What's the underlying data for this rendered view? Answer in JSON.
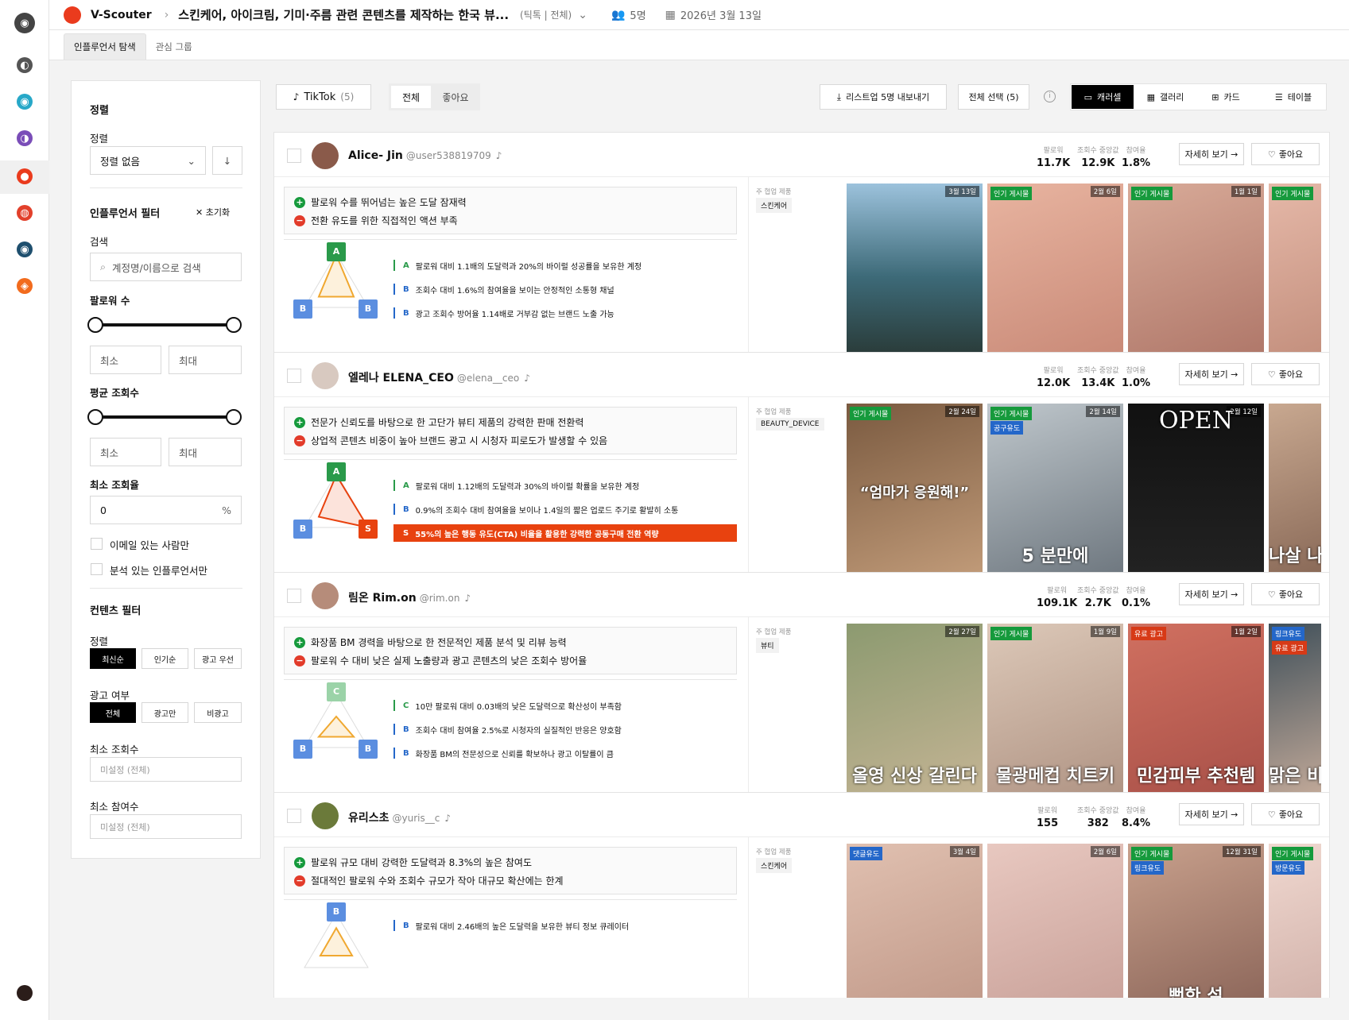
{
  "app": {
    "name": "V-Scouter",
    "project_title": "스킨케어, 아이크림, 기미·주름 관련 콘텐츠를 제작하는 한국 뷰...",
    "scope": "(틱톡 | 전체)",
    "members": "5명",
    "date": "2026년 3월 13일"
  },
  "subnav": {
    "tabs": [
      "인플루언서 탐색",
      "관심 그룹"
    ],
    "active": 0
  },
  "sidebar": {
    "sort_title": "정렬",
    "sort_label": "정렬",
    "sort_value": "정렬 없음",
    "filter_title": "인플루언서 필터",
    "reset": "초기화",
    "search_label": "검색",
    "search_placeholder": "계정명/이름으로 검색",
    "followers_label": "팔로워 수",
    "min": "최소",
    "max": "최대",
    "avg_views_label": "평균 조회수",
    "min_view_rate_label": "최소 조회율",
    "min_view_rate_value": "0",
    "percent": "%",
    "email_only": "이메일 있는 사람만",
    "analyzed_only": "분석 있는 인플루언서만",
    "content_filter_title": "컨텐츠 필터",
    "content_sort_label": "정렬",
    "content_sort_options": [
      "최신순",
      "인기순",
      "광고 우선"
    ],
    "ad_label": "광고 여부",
    "ad_options": [
      "전체",
      "광고만",
      "비광고"
    ],
    "min_views_label": "최소 조회수",
    "min_views_placeholder": "미설정 (전체)",
    "min_engage_label": "최소 참여수",
    "min_engage_placeholder": "미설정 (전체)"
  },
  "toolbar": {
    "platform": "TikTok",
    "platform_count": "(5)",
    "filter_all": "전체",
    "filter_liked": "좋아요",
    "export": "리스트업 5명 내보내기",
    "select_all": "전체 선택 (5)",
    "views": [
      "캐러셀",
      "갤러리",
      "카드",
      "테이블"
    ],
    "active_view": 0
  },
  "labels": {
    "followers": "팔로워",
    "median_views": "조회수 중앙값",
    "engagement": "참여율",
    "detail": "자세히 보기 →",
    "like": "좋아요",
    "product": "주 협업 제품"
  },
  "influencers": [
    {
      "name": "Alice- Jin",
      "handle": "@user538819709",
      "followers": "11.7K",
      "median_views": "12.9K",
      "engagement": "1.8%",
      "pro": "팔로워 수를 뛰어넘는 높은 도달 잠재력",
      "con": "전환 유도를 위한 직접적인 액션 부족",
      "grades": [
        {
          "g": "A",
          "t": "팔로워 대비 1.1배의 도달력과 20%의 바이럴 성공률을 보유한 계정"
        },
        {
          "g": "B",
          "t": "조회수 대비 1.6%의 참여율을 보이는 안정적인 소통형 채널"
        },
        {
          "g": "B",
          "t": "광고 조회수 방어율 1.14배로 거부감 없는 브랜드 노출 가능"
        }
      ],
      "product": "스킨케어",
      "posts": [
        {
          "badge": "",
          "date": "3월 13일",
          "caption": ""
        },
        {
          "badge": "인기 게시물",
          "date": "2월 6일",
          "caption": ""
        },
        {
          "badge": "인기 게시물",
          "date": "1월 1일",
          "caption": ""
        },
        {
          "badge": "인기 게시물",
          "date": "",
          "caption": ""
        }
      ]
    },
    {
      "name": "엘레나 ELENA_CEO",
      "handle": "@elena__ceo",
      "followers": "12.0K",
      "median_views": "13.4K",
      "engagement": "1.0%",
      "pro": "전문가 신뢰도를 바탕으로 한 고단가 뷰티 제품의 강력한 판매 전환력",
      "con": "상업적 콘텐츠 비중이 높아 브랜드 광고 시 시청자 피로도가 발생할 수 있음",
      "grades": [
        {
          "g": "A",
          "t": "팔로워 대비 1.12배의 도달력과 30%의 바이럴 확률을 보유한 계정"
        },
        {
          "g": "B",
          "t": "0.9%의 조회수 대비 참여율을 보이나 1.4일의 짧은 업로드 주기로 활발히 소통"
        },
        {
          "g": "S",
          "t": "55%의 높은 행동 유도(CTA) 비율을 활용한 강력한 공동구매 전환 역량"
        }
      ],
      "product": "BEAUTY_DEVICE",
      "posts": [
        {
          "badge": "인기 게시물",
          "date": "2월 24일",
          "caption": "“엄마가 응원해!”"
        },
        {
          "badge": "인기 게시물",
          "badge2": "공구유도",
          "date": "2월 14일",
          "caption": "5 분만에"
        },
        {
          "badge": "",
          "date": "2월 12일",
          "caption": "OPEN"
        },
        {
          "badge": "",
          "date": "",
          "caption": "나살 나이"
        }
      ]
    },
    {
      "name": "림온 Rim.on",
      "handle": "@rim.on",
      "followers": "109.1K",
      "median_views": "2.7K",
      "engagement": "0.1%",
      "pro": "화장품 BM 경력을 바탕으로 한 전문적인 제품 분석 및 리뷰 능력",
      "con": "팔로워 수 대비 낮은 실제 노출량과 광고 콘텐츠의 낮은 조회수 방어율",
      "grades": [
        {
          "g": "C",
          "t": "10만 팔로워 대비 0.03배의 낮은 도달력으로 확산성이 부족함"
        },
        {
          "g": "B",
          "t": "조회수 대비 참여율 2.5%로 시청자의 실질적인 반응은 양호함"
        },
        {
          "g": "B",
          "t": "화장품 BM의 전문성으로 신뢰를 확보하나 광고 이탈률이 큼"
        }
      ],
      "product": "뷰티",
      "posts": [
        {
          "badge": "",
          "date": "2월 27일",
          "caption": "올영 신상 갈린다"
        },
        {
          "badge": "인기 게시물",
          "date": "1월 9일",
          "caption": "물광메컵 치트키"
        },
        {
          "badge": "유료 광고",
          "date": "1월 2일",
          "caption": "민감피부 추천템"
        },
        {
          "badge": "링크유도",
          "badge2": "유료 광고",
          "date": "",
          "caption": "맑은 비"
        }
      ]
    },
    {
      "name": "유리스초",
      "handle": "@yuris__c",
      "followers": "155",
      "median_views": "382",
      "engagement": "8.4%",
      "pro": "팔로워 규모 대비 강력한 도달력과 8.3%의 높은 참여도",
      "con": "절대적인 팔로워 수와 조회수 규모가 작아 대규모 확산에는 한계",
      "grades": [
        {
          "g": "B",
          "t": "팔로워 대비 2.46배의 높은 도달력을 보유한 뷰티 정보 큐레이터"
        }
      ],
      "product": "스킨케어",
      "posts": [
        {
          "badge": "댓글유도",
          "date": "3월 4일",
          "caption": ""
        },
        {
          "badge": "",
          "date": "2월 6일",
          "caption": ""
        },
        {
          "badge": "인기 게시물",
          "badge2": "링크유도",
          "date": "12월 31일",
          "caption": "뻔한 설"
        },
        {
          "badge": "인기 게시물",
          "badge2": "방문유도",
          "date": "",
          "caption": ""
        }
      ]
    }
  ]
}
